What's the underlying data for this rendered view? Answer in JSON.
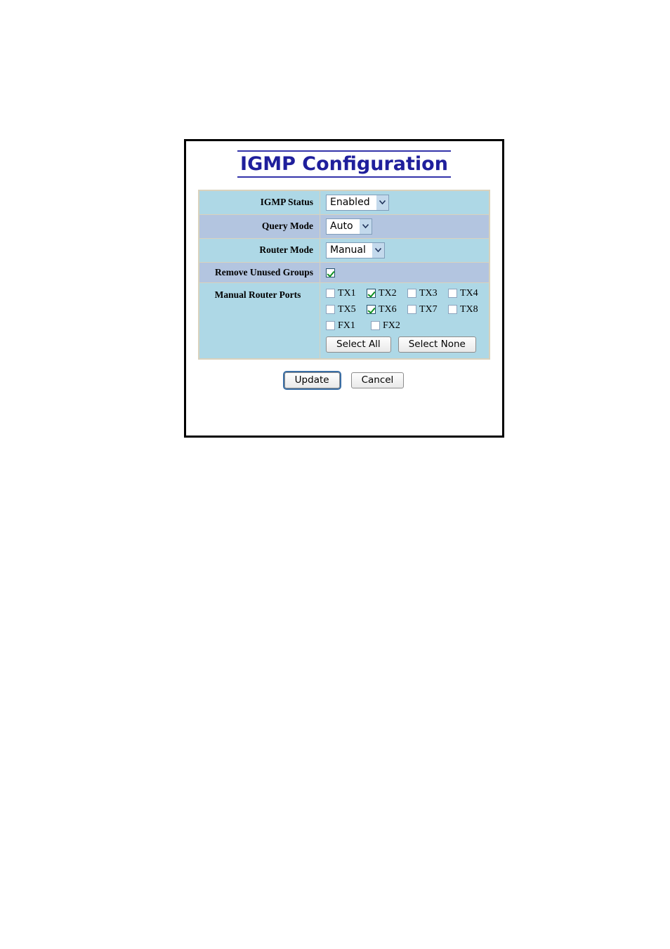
{
  "page": {
    "title": "IGMP Configuration"
  },
  "settings": {
    "rows": [
      {
        "label": "IGMP Status",
        "control": "select",
        "value": "Enabled"
      },
      {
        "label": "Query Mode",
        "control": "select",
        "value": "Auto"
      },
      {
        "label": "Router Mode",
        "control": "select",
        "value": "Manual"
      },
      {
        "label": "Remove Unused Groups",
        "control": "checkbox",
        "checked": true
      },
      {
        "label": "Manual Router Ports",
        "control": "ports"
      }
    ]
  },
  "ports": {
    "rows": [
      [
        {
          "label": "TX1",
          "checked": false
        },
        {
          "label": "TX2",
          "checked": true
        },
        {
          "label": "TX3",
          "checked": false
        },
        {
          "label": "TX4",
          "checked": false
        }
      ],
      [
        {
          "label": "TX5",
          "checked": false
        },
        {
          "label": "TX6",
          "checked": true
        },
        {
          "label": "TX7",
          "checked": false
        },
        {
          "label": "TX8",
          "checked": false
        }
      ],
      [
        {
          "label": "FX1",
          "checked": false
        },
        {
          "label": "FX2",
          "checked": false
        }
      ]
    ],
    "select_all_label": "Select All",
    "select_none_label": "Select None"
  },
  "actions": {
    "update_label": "Update",
    "cancel_label": "Cancel"
  },
  "colors": {
    "title_text": "#1f1f9c",
    "row_cyan": "#aed8e6",
    "row_blue": "#b3c5e0",
    "table_border": "#d9d2bd",
    "check_green": "#0f9020",
    "focus_blue": "#3a6ea5"
  }
}
